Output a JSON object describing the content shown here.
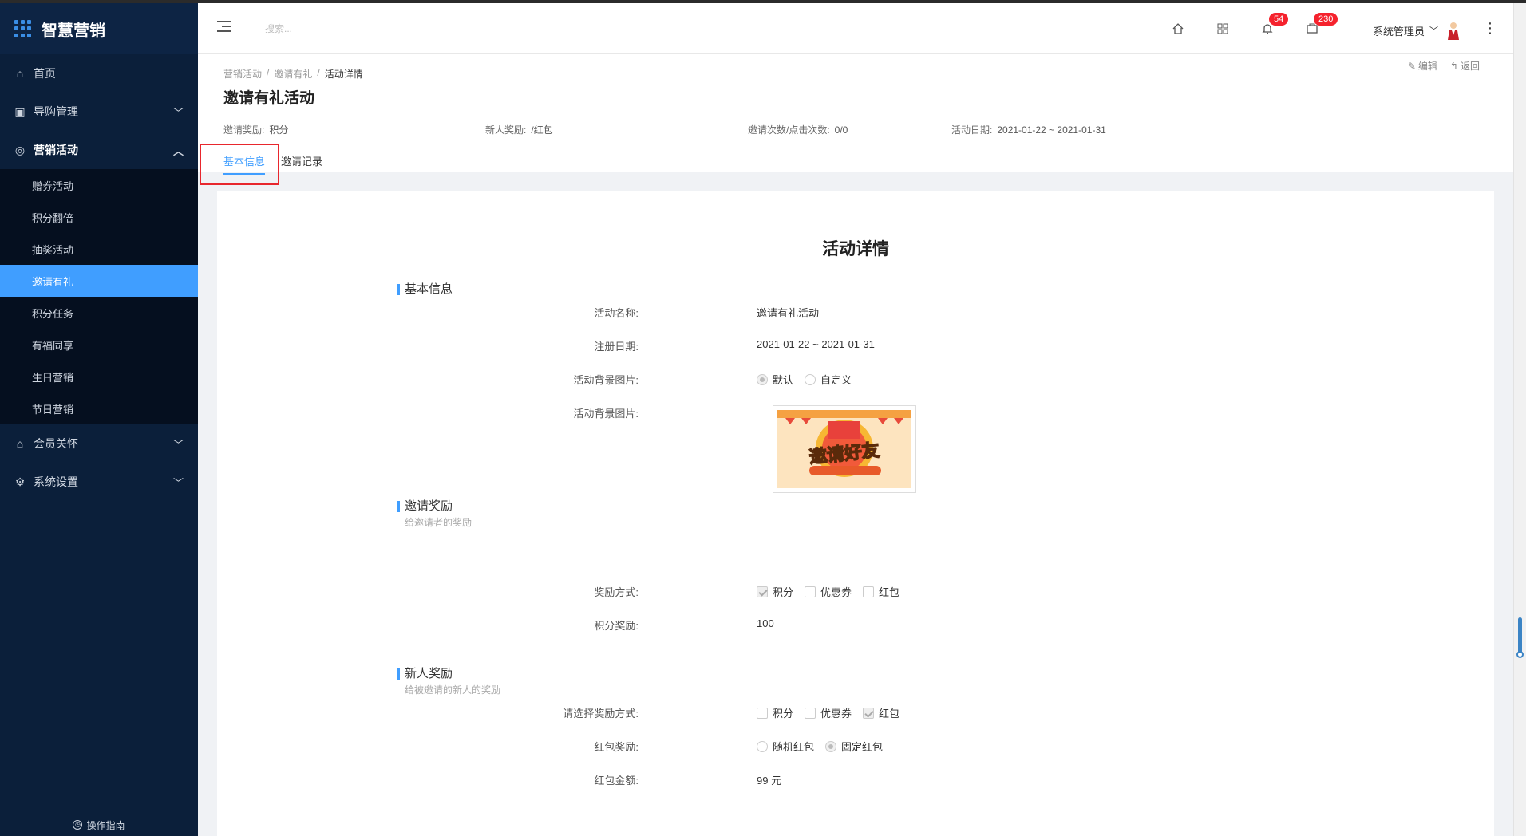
{
  "brand": {
    "name": "智慧营销"
  },
  "sidebar": {
    "items": [
      {
        "label": "首页",
        "icon": "home-icon"
      },
      {
        "label": "导购管理",
        "icon": "bag-icon"
      },
      {
        "label": "营销活动",
        "icon": "target-icon"
      },
      {
        "label": "会员关怀",
        "icon": "home-icon"
      },
      {
        "label": "系统设置",
        "icon": "gear-icon"
      }
    ],
    "sub_items": [
      "赠券活动",
      "积分翻倍",
      "抽奖活动",
      "邀请有礼",
      "积分任务",
      "有福同享",
      "生日营销",
      "节日营销"
    ],
    "active_sub": "邀请有礼",
    "guide": "操作指南"
  },
  "header": {
    "search_placeholder": "搜索...",
    "notifications_count": "54",
    "messages_count": "230",
    "user_name": "系统管理员"
  },
  "breadcrumb": [
    "营销活动",
    "邀请有礼",
    "活动详情"
  ],
  "actions": {
    "edit": "编辑",
    "back": "返回"
  },
  "page_title": "邀请有礼活动",
  "meta": [
    {
      "label": "邀请奖励:",
      "value": "积分"
    },
    {
      "label": "新人奖励:",
      "value": "/红包"
    },
    {
      "label": "邀请次数/点击次数:",
      "value": "0/0"
    },
    {
      "label": "活动日期:",
      "value": "2021-01-22 ~ 2021-01-31"
    }
  ],
  "tabs": [
    "基本信息",
    "邀请记录"
  ],
  "detail": {
    "title": "活动详情",
    "basic": {
      "section_title": "基本信息",
      "name_label": "活动名称:",
      "name_value": "邀请有礼活动",
      "date_label": "注册日期:",
      "date_value": "2021-01-22 ~ 2021-01-31",
      "bg_label": "活动背景图片:",
      "bg_options": [
        "默认",
        "自定义"
      ],
      "bg_image_label": "活动背景图片:",
      "bg_image_text": "邀请好友"
    },
    "invite_reward": {
      "section_title": "邀请奖励",
      "section_sub": "给邀请者的奖励",
      "mode_label": "奖励方式:",
      "mode_options": [
        "积分",
        "优惠券",
        "红包"
      ],
      "points_label": "积分奖励:",
      "points_value": "100"
    },
    "newbie_reward": {
      "section_title": "新人奖励",
      "section_sub": "给被邀请的新人的奖励",
      "mode_label": "请选择奖励方式:",
      "mode_options": [
        "积分",
        "优惠券",
        "红包"
      ],
      "redpack_label": "红包奖励:",
      "redpack_options": [
        "随机红包",
        "固定红包"
      ],
      "amount_label": "红包金额:",
      "amount_value": "99 元"
    }
  },
  "colors": {
    "primary": "#409eff",
    "sidebar": "#0b1f3a",
    "highlight": "#e8272d",
    "badge": "#f5222d"
  }
}
